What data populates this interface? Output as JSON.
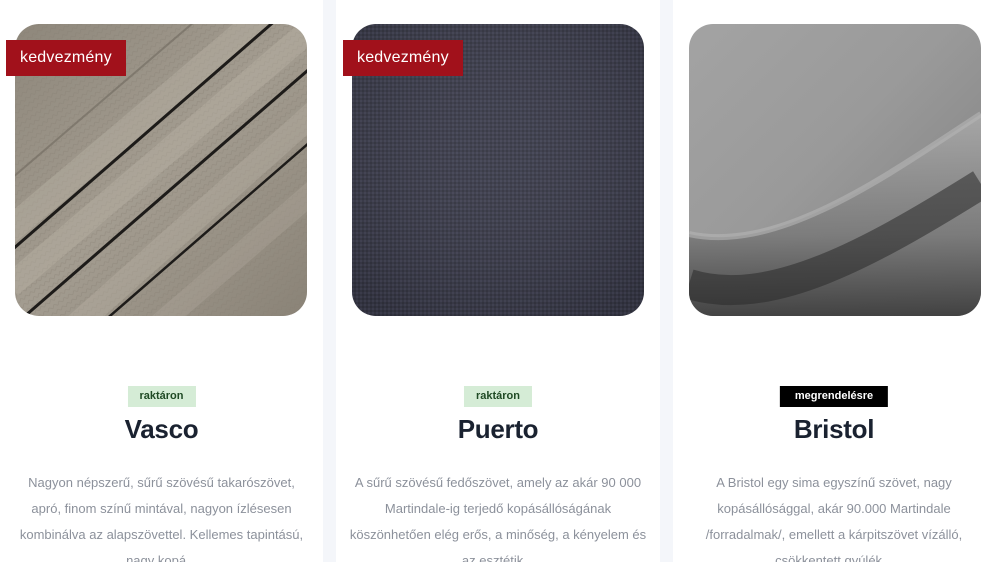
{
  "products": [
    {
      "promo_badge": "kedvezmény",
      "stock_status": "raktáron",
      "title": "Vasco",
      "description": "Nagyon népszerű, sűrű szövésű takarószövet, apró, finom színű mintával, nagyon ízlésesen kombinálva az alapszövettel. Kellemes tapintású, nagy kopá...",
      "image_icon": "fabric-swatch-taupe",
      "swatch_color": "#9e978b"
    },
    {
      "promo_badge": "kedvezmény",
      "stock_status": "raktáron",
      "title": "Puerto",
      "description": "A sűrű szövésű fedőszövet, amely az akár 90 000 Martindale-ig terjedő kopásállóságának köszönhetően elég erős, a minőség, a kényelem és az esztétik...",
      "image_icon": "fabric-swatch-charcoal",
      "swatch_color": "#393a49"
    },
    {
      "promo_badge": "",
      "stock_status": "megrendelésre",
      "title": "Bristol",
      "description": "A Bristol egy sima egyszínű szövet, nagy kopásállósággal, akár 90.000 Martindale /forradalmak/, emellett a kárpitszövet vízálló, csökkentett gyúlék...",
      "image_icon": "fabric-swatch-grey",
      "swatch_color": "#959595"
    }
  ],
  "colors": {
    "promo_badge": "#a1111b",
    "stock_in_bg": "#d5ecd6",
    "stock_order_bg": "#000000",
    "title": "#1a2230",
    "description": "#8c919b",
    "page_bg": "#f4f6fa"
  }
}
